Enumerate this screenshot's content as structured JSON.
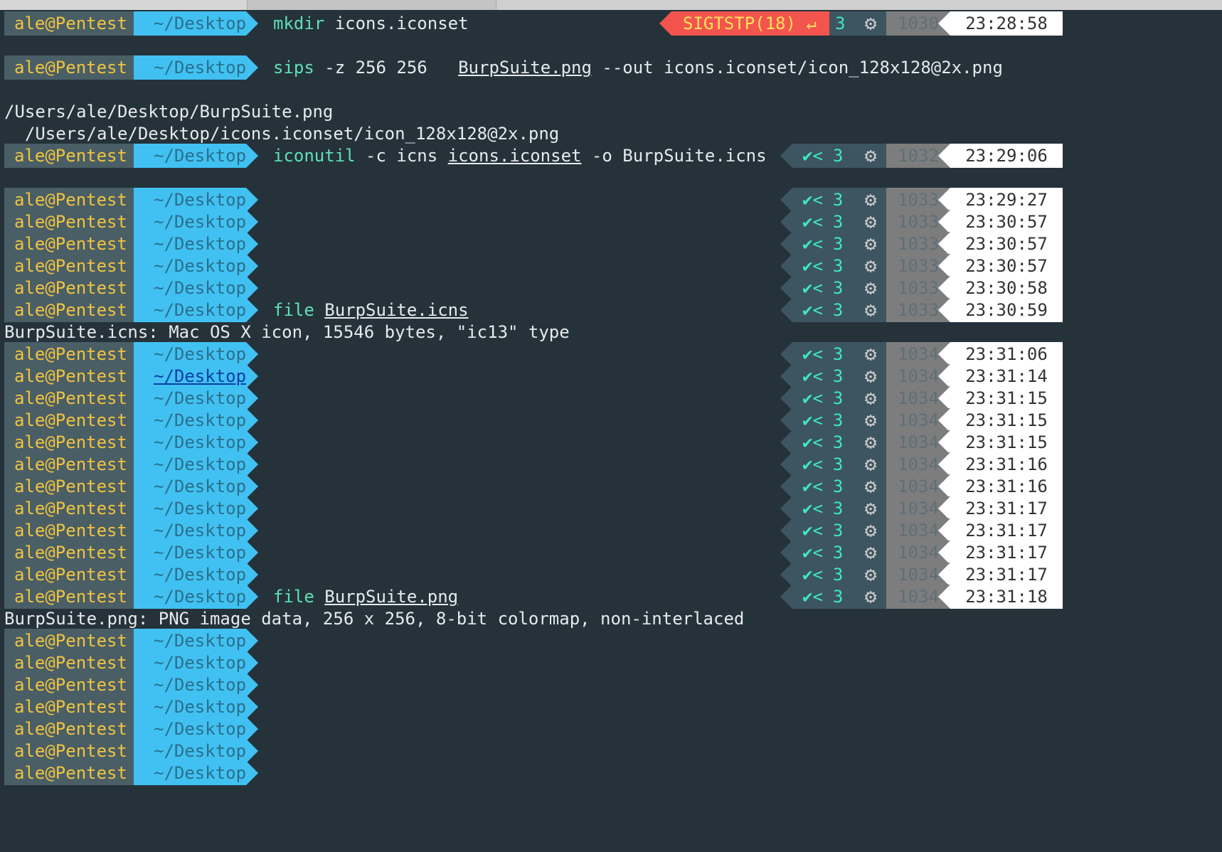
{
  "prompt": {
    "user": "ale@Pentest",
    "dir": "~/Desktop"
  },
  "lines": [
    {
      "kind": "prompt",
      "cmd_prog": "mkdir",
      "cmd_rest": " icons.iconset",
      "right": "sig",
      "signal": "SIGTSTP(18)",
      "return_icon": "↵",
      "jobs": "3",
      "hist": "1030",
      "time": "23:28:58"
    },
    {
      "kind": "blank"
    },
    {
      "kind": "prompt",
      "cmd_prog": "sips",
      "cmd_rest": " -z 256 256   ",
      "cmd_ul": "BurpSuite.png",
      "cmd_tail": " --out icons.iconset/icon_128x128@2x.png"
    },
    {
      "kind": "blank"
    },
    {
      "kind": "output",
      "text": "/Users/ale/Desktop/BurpSuite.png"
    },
    {
      "kind": "output",
      "text": "  /Users/ale/Desktop/icons.iconset/icon_128x128@2x.png"
    },
    {
      "kind": "prompt",
      "cmd_prog": "iconutil",
      "cmd_rest": " -c icns ",
      "cmd_ul": "icons.iconset",
      "cmd_tail": " -o BurpSuite.icns",
      "right": "ok",
      "check": "✔",
      "lt": "<",
      "jobs": "3",
      "hist": "1032",
      "time": "23:29:06"
    },
    {
      "kind": "blank"
    },
    {
      "kind": "prompt",
      "right": "ok",
      "check": "✔",
      "lt": "<",
      "jobs": "3",
      "hist": "1033",
      "time": "23:29:27"
    },
    {
      "kind": "prompt",
      "right": "ok",
      "check": "✔",
      "lt": "<",
      "jobs": "3",
      "hist": "1033",
      "time": "23:30:57"
    },
    {
      "kind": "prompt",
      "right": "ok",
      "check": "✔",
      "lt": "<",
      "jobs": "3",
      "hist": "1033",
      "time": "23:30:57"
    },
    {
      "kind": "prompt",
      "right": "ok",
      "check": "✔",
      "lt": "<",
      "jobs": "3",
      "hist": "1033",
      "time": "23:30:57"
    },
    {
      "kind": "prompt",
      "right": "ok",
      "check": "✔",
      "lt": "<",
      "jobs": "3",
      "hist": "1033",
      "time": "23:30:58"
    },
    {
      "kind": "prompt",
      "cmd_prog": "file",
      "cmd_rest": " ",
      "cmd_ul": "BurpSuite.icns",
      "right": "ok",
      "check": "✔",
      "lt": "<",
      "jobs": "3",
      "hist": "1033",
      "time": "23:30:59"
    },
    {
      "kind": "output",
      "text": "BurpSuite.icns: Mac OS X icon, 15546 bytes, \"ic13\" type"
    },
    {
      "kind": "prompt",
      "right": "ok",
      "check": "✔",
      "lt": "<",
      "jobs": "3",
      "hist": "1034",
      "time": "23:31:06"
    },
    {
      "kind": "prompt",
      "dir_highlight": true,
      "right": "ok",
      "check": "✔",
      "lt": "<",
      "jobs": "3",
      "hist": "1034",
      "time": "23:31:14"
    },
    {
      "kind": "prompt",
      "right": "ok",
      "check": "✔",
      "lt": "<",
      "jobs": "3",
      "hist": "1034",
      "time": "23:31:15"
    },
    {
      "kind": "prompt",
      "right": "ok",
      "check": "✔",
      "lt": "<",
      "jobs": "3",
      "hist": "1034",
      "time": "23:31:15"
    },
    {
      "kind": "prompt",
      "right": "ok",
      "check": "✔",
      "lt": "<",
      "jobs": "3",
      "hist": "1034",
      "time": "23:31:15"
    },
    {
      "kind": "prompt",
      "right": "ok",
      "check": "✔",
      "lt": "<",
      "jobs": "3",
      "hist": "1034",
      "time": "23:31:16"
    },
    {
      "kind": "prompt",
      "right": "ok",
      "check": "✔",
      "lt": "<",
      "jobs": "3",
      "hist": "1034",
      "time": "23:31:16"
    },
    {
      "kind": "prompt",
      "right": "ok",
      "check": "✔",
      "lt": "<",
      "jobs": "3",
      "hist": "1034",
      "time": "23:31:17"
    },
    {
      "kind": "prompt",
      "right": "ok",
      "check": "✔",
      "lt": "<",
      "jobs": "3",
      "hist": "1034",
      "time": "23:31:17"
    },
    {
      "kind": "prompt",
      "right": "ok",
      "check": "✔",
      "lt": "<",
      "jobs": "3",
      "hist": "1034",
      "time": "23:31:17"
    },
    {
      "kind": "prompt",
      "right": "ok",
      "check": "✔",
      "lt": "<",
      "jobs": "3",
      "hist": "1034",
      "time": "23:31:17"
    },
    {
      "kind": "prompt",
      "cmd_prog": "file",
      "cmd_rest": " ",
      "cmd_ul": "BurpSuite.png",
      "right": "ok",
      "check": "✔",
      "lt": "<",
      "jobs": "3",
      "hist": "1034",
      "time": "23:31:18"
    },
    {
      "kind": "output",
      "text": "BurpSuite.png: PNG image data, 256 x 256, 8-bit colormap, non-interlaced"
    },
    {
      "kind": "prompt"
    },
    {
      "kind": "prompt"
    },
    {
      "kind": "prompt"
    },
    {
      "kind": "prompt"
    },
    {
      "kind": "prompt"
    },
    {
      "kind": "prompt"
    },
    {
      "kind": "prompt"
    }
  ],
  "icons": {
    "gear": "gear-icon",
    "return": "return-icon",
    "check": "check-icon"
  },
  "colors": {
    "background": "#25323a",
    "user_segment": "#4a5e66",
    "user_text": "#f0c43f",
    "dir_segment": "#41c1f2",
    "command": "#5fe0b5",
    "status_ok": "#3ee8c2",
    "signal_bg": "#f3544e",
    "signal_text": "#ffe25a",
    "time_bg": "#ffffff"
  }
}
